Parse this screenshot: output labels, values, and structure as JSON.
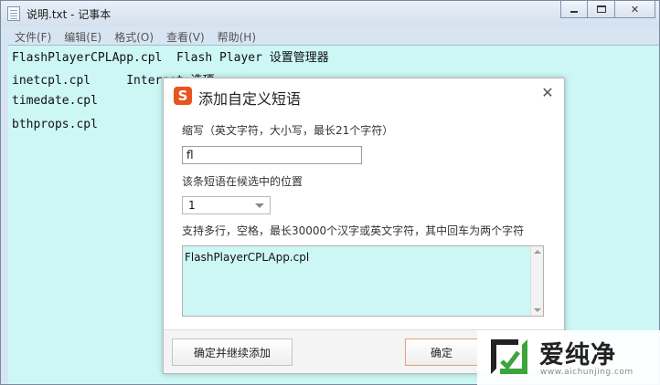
{
  "window": {
    "title": "说明.txt - 记事本"
  },
  "menubar": {
    "items": [
      {
        "label": "文件(F)"
      },
      {
        "label": "编辑(E)"
      },
      {
        "label": "格式(O)"
      },
      {
        "label": "查看(V)"
      },
      {
        "label": "帮助(H)"
      }
    ]
  },
  "editor": {
    "lines": [
      "FlashPlayerCPLApp.cpl  Flash Player 设置管理器",
      "inetcpl.cpl     Internet 选项",
      "timedate.cpl",
      "bthprops.cpl"
    ],
    "background": "#ccf7f5"
  },
  "dialog": {
    "title": "添加自定义短语",
    "logo_letter": "S",
    "abbr_label": "缩写（英文字符，大小写，最长21个字符）",
    "abbr_value": "fl",
    "position_label": "该条短语在候选中的位置",
    "position_value": "1",
    "content_label": "支持多行，空格，最长30000个汉字或英文字符，其中回车为两个字符",
    "content_value": "FlashPlayerCPLApp.cpl",
    "btn_continue": "确定并继续添加",
    "btn_ok": "确定",
    "logo_color": "#e8531f"
  },
  "watermark": {
    "text": "爱纯净",
    "url": "www.aichunjing.com",
    "accent": "#3aa53a"
  }
}
